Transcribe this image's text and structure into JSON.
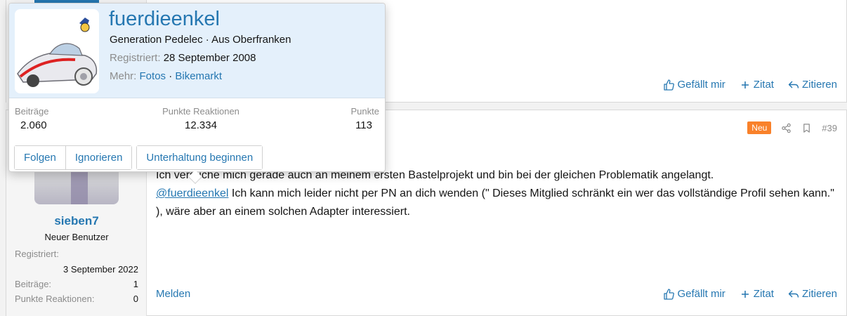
{
  "previous_post": {
    "actions": {
      "like": "Gefällt mir",
      "quote": "Zitat",
      "reply": "Zitieren"
    }
  },
  "post": {
    "badge": "Neu",
    "number": "#39",
    "author": {
      "username": "sieben7",
      "title": "Neuer Benutzer",
      "registered_label": "Registriert:",
      "registered_value": "3 September 2022",
      "posts_label": "Beiträge:",
      "posts_value": "1",
      "reactions_label": "Punkte Reaktionen:",
      "reactions_value": "0"
    },
    "body": {
      "line1": "Ich versuche mich gerade auch an meinem ersten Bastelprojekt und bin bei der gleichen Problematik angelangt.",
      "mention": "@fuerdieenkel",
      "line2_rest": " Ich kann mich leider nicht per PN an dich wenden (\" Dieses Mitglied schränkt ein wer das vollständige Profil sehen kann.\" ), wäre aber an einem solchen Adapter interessiert."
    },
    "report": "Melden",
    "actions": {
      "like": "Gefällt mir",
      "quote": "Zitat",
      "reply": "Zitieren"
    }
  },
  "tooltip": {
    "username": "fuerdieenkel",
    "subtitle": "Generation Pedelec · Aus Oberfranken",
    "registered_label": "Registriert:",
    "registered_value": "28 September 2008",
    "more_label": "Mehr:",
    "more_link1": "Fotos",
    "more_sep": " · ",
    "more_link2": "Bikemarkt",
    "stats": {
      "posts_label": "Beiträge",
      "posts_value": "2.060",
      "reactions_label": "Punkte Reaktionen",
      "reactions_value": "12.334",
      "points_label": "Punkte",
      "points_value": "113"
    },
    "buttons": {
      "follow": "Folgen",
      "ignore": "Ignorieren",
      "conversation": "Unterhaltung beginnen"
    }
  },
  "colors": {
    "link": "#2577b1",
    "badge_new": "#f9812a",
    "tooltip_header": "#e4f0fb"
  },
  "icons": [
    "thumbs-up-icon",
    "plus-icon",
    "reply-icon",
    "share-icon",
    "bookmark-icon"
  ]
}
